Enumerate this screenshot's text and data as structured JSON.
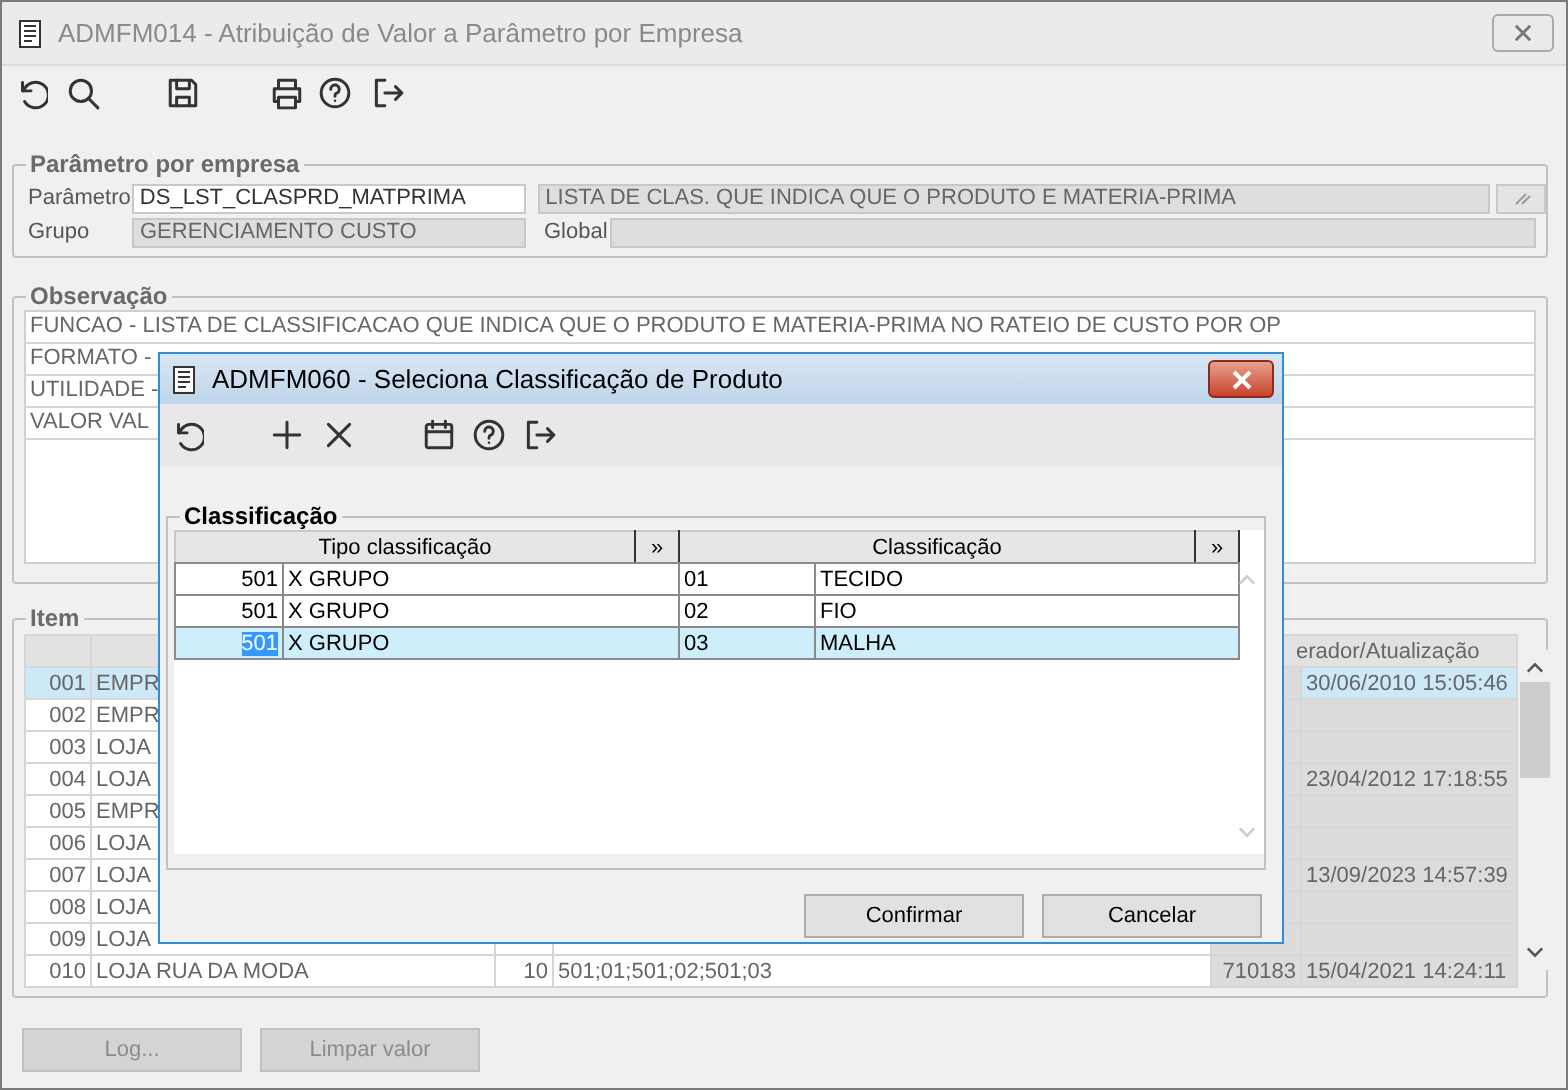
{
  "window": {
    "title": "ADMFM014 - Atribuição de Valor a Parâmetro por Empresa"
  },
  "parametro_group": {
    "legend": "Parâmetro por empresa",
    "parametro_label": "Parâmetro",
    "parametro_value": "DS_LST_CLASPRD_MATPRIMA",
    "description": "LISTA DE CLAS. QUE INDICA QUE O PRODUTO E MATERIA-PRIMA",
    "grupo_label": "Grupo",
    "grupo_value": "GERENCIAMENTO CUSTO",
    "global_label": "Global"
  },
  "observacao": {
    "legend": "Observação",
    "lines": [
      "FUNCAO - LISTA DE CLASSIFICACAO QUE INDICA QUE O PRODUTO E MATERIA-PRIMA NO RATEIO DE CUSTO POR OP",
      "FORMATO -",
      "UTILIDADE -",
      "VALOR VAL"
    ]
  },
  "item": {
    "legend": "Item",
    "header": "erador/Atualização",
    "rows": [
      {
        "number": "001",
        "name": "EMPR",
        "selected": true,
        "date": "30/06/2010 15:05:46"
      },
      {
        "number": "002",
        "name": "EMPR",
        "selected": false
      },
      {
        "number": "003",
        "name": "LOJA",
        "selected": false
      },
      {
        "number": "004",
        "name": "LOJA",
        "selected": false,
        "date": "23/04/2012 17:18:55"
      },
      {
        "number": "005",
        "name": "EMPR",
        "selected": false
      },
      {
        "number": "006",
        "name": "LOJA",
        "selected": false
      },
      {
        "number": "007",
        "name": "LOJA",
        "selected": false,
        "date": "13/09/2023 14:57:39"
      },
      {
        "number": "008",
        "name": "LOJA",
        "selected": false
      },
      {
        "number": "009",
        "name": "LOJA",
        "selected": false
      },
      {
        "number": "010",
        "name": "LOJA RUA DA MODA",
        "selected": false,
        "quantity": "10",
        "value": "501;01;501;02;501;03",
        "operator": "710183",
        "date": "15/04/2021 14:24:11"
      }
    ]
  },
  "buttons": [
    {
      "label": "Log...",
      "disabled": true
    },
    {
      "label": "Limpar valor",
      "disabled": true
    }
  ],
  "dialog": {
    "title": "ADMFM060 - Seleciona Classificação de Produto",
    "legend": "Classificação",
    "columns": [
      {
        "label": "Tipo classificação",
        "expand": "»"
      },
      {
        "label": "Classificação",
        "expand": "»"
      }
    ],
    "rows": [
      {
        "type_code": "501",
        "type_name": "X GRUPO",
        "code": "01",
        "name": "TECIDO",
        "selected": false
      },
      {
        "type_code": "501",
        "type_name": "X GRUPO",
        "code": "02",
        "name": "FIO",
        "selected": false
      },
      {
        "type_code": "501",
        "type_name": "X GRUPO",
        "code": "03",
        "name": "MALHA",
        "selected": true
      }
    ],
    "buttons": [
      "Confirmar",
      "Cancelar"
    ]
  }
}
